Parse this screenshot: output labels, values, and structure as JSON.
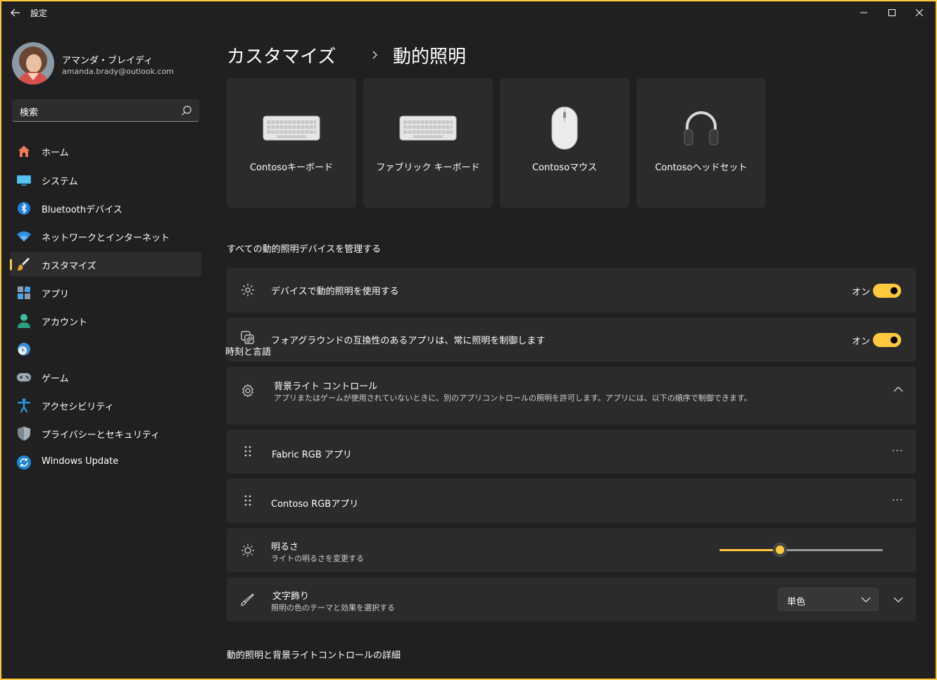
{
  "window": {
    "title": "設定"
  },
  "profile": {
    "name": "アマンダ・ブレイディ",
    "email": "amanda.brady@outlook.com"
  },
  "search": {
    "placeholder": "検索"
  },
  "nav": {
    "items": [
      {
        "label": "ホーム",
        "icon": "home-icon"
      },
      {
        "label": "システム",
        "icon": "system-icon"
      },
      {
        "label": "Bluetoothデバイス",
        "icon": "bluetooth-icon"
      },
      {
        "label": "ネットワークとインターネット",
        "icon": "wifi-icon"
      },
      {
        "label": "カスタマイズ",
        "icon": "brush-icon",
        "selected": true
      },
      {
        "label": "アプリ",
        "icon": "apps-icon"
      },
      {
        "label": "アカウント",
        "icon": "account-icon"
      },
      {
        "label": "時刻と言語",
        "icon": "time-language-icon"
      },
      {
        "label": "ゲーム",
        "icon": "gamepad-icon"
      },
      {
        "label": "アクセシビリティ",
        "icon": "accessibility-icon"
      },
      {
        "label": "プライバシーとセキュリティ",
        "icon": "shield-icon"
      },
      {
        "label": "Windows Update",
        "icon": "update-icon"
      }
    ]
  },
  "breadcrumb": {
    "parent": "カスタマイズ",
    "current": "動的照明"
  },
  "devices": [
    {
      "label": "Contosoキーボード",
      "icon": "keyboard-icon"
    },
    {
      "label": "ファブリック キーボード",
      "icon": "keyboard-icon"
    },
    {
      "label": "Contosoマウス",
      "icon": "mouse-icon"
    },
    {
      "label": "Contosoヘッドセット",
      "icon": "headset-icon"
    }
  ],
  "manage_section": {
    "label": "すべての動的照明デバイスを管理する"
  },
  "settings": {
    "use_dynamic_lighting": {
      "title": "デバイスで動的照明を使用する",
      "state": "オン"
    },
    "foreground_apps": {
      "title": "フォアグラウンドの互換性のあるアプリは、常に照明を制御します",
      "state": "オン"
    },
    "background_control": {
      "title": "背景ライト コントロール",
      "description": "アプリまたはゲームが使用されていないときに、別のアプリコントロールの照明を許可します。アプリには、以下の順序で制御できます。"
    },
    "apps": [
      {
        "name": "Fabric RGB アプリ",
        "more": "···"
      },
      {
        "name": "Contoso RGBアプリ",
        "more": "···"
      }
    ],
    "brightness": {
      "title": "明るさ",
      "description": "ライトの明るさを変更する",
      "value": 0.37
    },
    "effects": {
      "title": "文字飾り",
      "description": "照明の色のテーマと効果を選択する",
      "selected": "単色"
    }
  },
  "details_section": {
    "label": "動的照明と背景ライトコントロールの詳細"
  },
  "colors": {
    "accent": "#ffc83d",
    "background": "#202020",
    "card": "#2b2b2b"
  }
}
